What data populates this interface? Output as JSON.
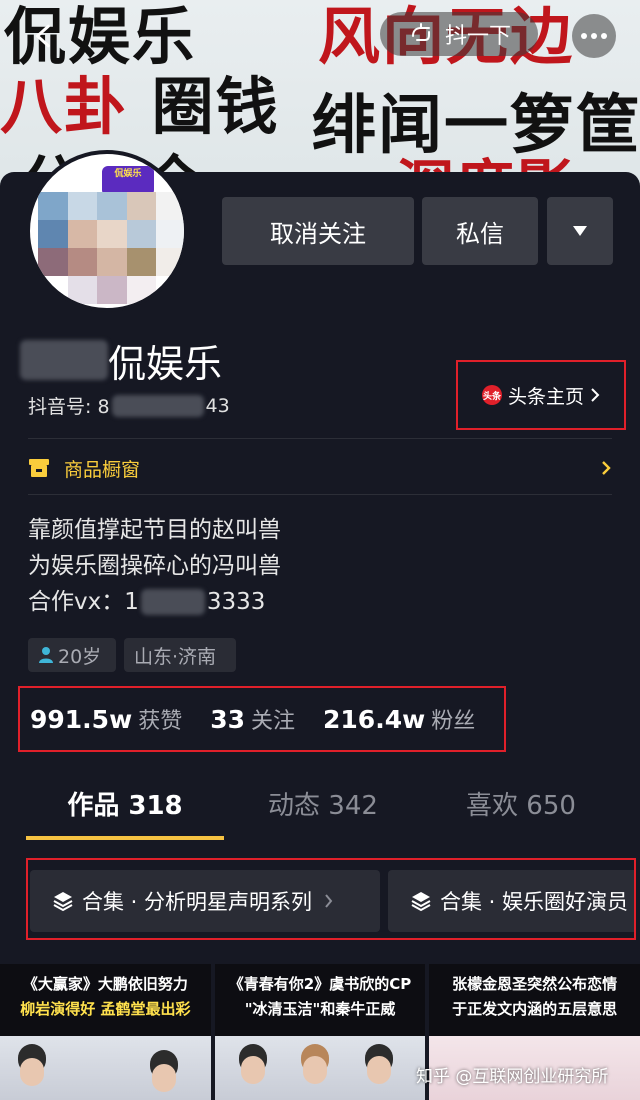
{
  "banner": {
    "lines": [
      "侃娱乐",
      "风向无边",
      "八卦",
      "圈钱",
      "绯闻一箩筐",
      "分享全",
      "深度影"
    ]
  },
  "topbar": {
    "back_icon": "back-arrow-icon",
    "shake_label": "抖一下",
    "more_icon": "more-dots-icon"
  },
  "avatar": {
    "logo_text": "侃娱乐"
  },
  "actions": {
    "unfollow_label": "取消关注",
    "message_label": "私信",
    "dropdown_icon": "triangle-down-icon"
  },
  "profile": {
    "name_suffix": "侃娱乐",
    "id_label": "抖音号: 8",
    "id_suffix": "43",
    "toutiao_badge": "头条",
    "toutiao_label": "头条主页"
  },
  "shop": {
    "label": "商品橱窗",
    "icon": "shop-icon"
  },
  "bio": {
    "line1": "靠颜值撑起节目的赵叫兽",
    "line2": "为娱乐圈操碎心的冯叫兽",
    "vx_prefix": "合作vx：1",
    "vx_suffix": "3333"
  },
  "tags": {
    "age": "20岁",
    "location": "山东·济南"
  },
  "stats": [
    {
      "num": "991.5w",
      "label": "获赞"
    },
    {
      "num": "33",
      "label": "关注"
    },
    {
      "num": "216.4w",
      "label": "粉丝"
    }
  ],
  "tabs": [
    "作品 318",
    "动态 342",
    "喜欢 650"
  ],
  "collections": [
    {
      "label": "合集 · 分析明星声明系列"
    },
    {
      "label": "合集 · 娱乐圈好演员"
    }
  ],
  "videos": [
    {
      "line1": "《大赢家》大鹏依旧努力",
      "line2": "柳岩演得好 孟鹤堂最出彩"
    },
    {
      "line1": "《青春有你2》虞书欣的CP",
      "line2": "\"冰清玉洁\"和秦牛正威"
    },
    {
      "line1": "张檬金恩圣突然公布恋情",
      "line2": "于正发文内涵的五层意思"
    }
  ],
  "watermark": "知乎 @互联网创业研究所",
  "colors": {
    "accent_red": "#e0202a",
    "tab_underline": "#f6c242",
    "shop_yellow": "#facd3c",
    "background": "#161823"
  }
}
